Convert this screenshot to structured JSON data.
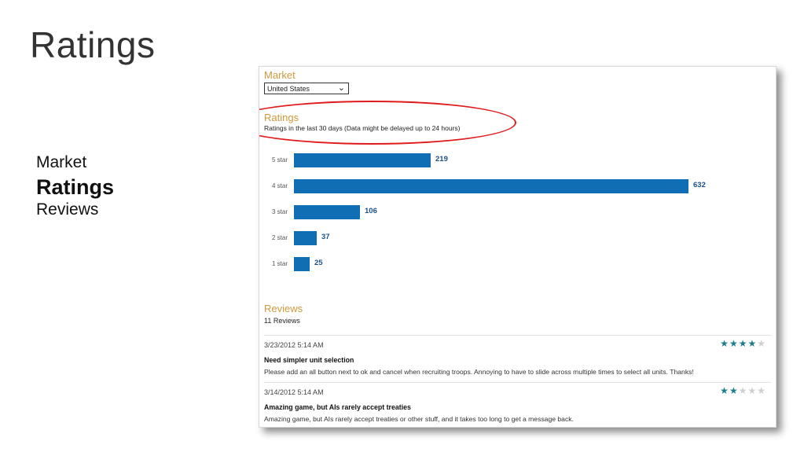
{
  "slide": {
    "title": "Ratings"
  },
  "nav": {
    "items": [
      "Market",
      "Ratings",
      "Reviews"
    ]
  },
  "panel": {
    "market": {
      "heading": "Market",
      "selected": "United States"
    },
    "ratings": {
      "heading": "Ratings",
      "subtitle": "Ratings in the last 30 days (Data might be delayed up to 24 hours)"
    },
    "reviews": {
      "heading": "Reviews",
      "count_text": "11 Reviews",
      "items": [
        {
          "date": "3/23/2012 5:14 AM",
          "stars": 4,
          "title": "Need simpler unit selection",
          "text": "Please add an all button next to ok and cancel when recruiting troops. Annoying to have to slide across multiple times to select all units. Thanks!"
        },
        {
          "date": "3/14/2012 5:14 AM",
          "stars": 2,
          "title": "Amazing game, but AIs rarely accept treaties",
          "text": "Amazing game, but AIs rarely accept treaties or other stuff, and it takes too long to get a message back."
        }
      ]
    }
  },
  "chart_data": {
    "type": "bar",
    "orientation": "horizontal",
    "categories": [
      "5 star",
      "4 star",
      "3 star",
      "2 star",
      "1 star"
    ],
    "values": [
      219,
      632,
      106,
      37,
      25
    ],
    "bar_color": "#0f6eb4"
  },
  "colors": {
    "heading": "#d19a3a",
    "bar": "#0f6eb4",
    "star_filled": "#1b7c8c",
    "star_empty": "#cfcfcf",
    "highlight": "#e01b1b"
  }
}
